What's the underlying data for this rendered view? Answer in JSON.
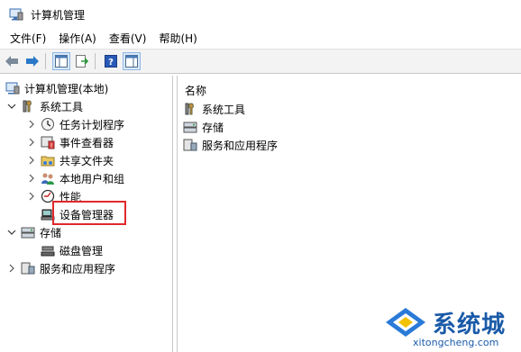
{
  "window": {
    "title": "计算机管理"
  },
  "menu": [
    "文件(F)",
    "操作(A)",
    "查看(V)",
    "帮助(H)"
  ],
  "tree": {
    "root": "计算机管理(本地)",
    "system_tools": "系统工具",
    "task_scheduler": "任务计划程序",
    "event_viewer": "事件查看器",
    "shared_folders": "共享文件夹",
    "local_users": "本地用户和组",
    "performance": "性能",
    "device_manager": "设备管理器",
    "storage": "存储",
    "disk_management": "磁盘管理",
    "services_apps": "服务和应用程序"
  },
  "list": {
    "column_name": "名称",
    "items": [
      "系统工具",
      "存储",
      "服务和应用程序"
    ]
  },
  "watermark": {
    "brand": "系统城",
    "url": "xitongcheng.com"
  },
  "colors": {
    "highlight": "#e0282c",
    "accent": "#1a5aa8"
  }
}
